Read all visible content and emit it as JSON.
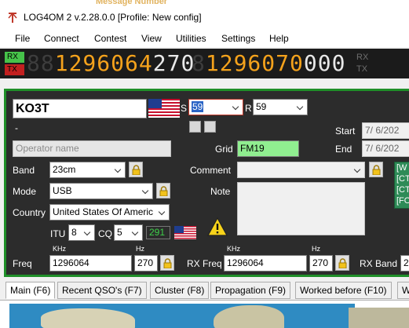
{
  "app": {
    "ghost_text": "Message Number",
    "title": "LOG4OM 2 v.2.28.0.0 [Profile: New config]"
  },
  "menu": [
    "File",
    "Connect",
    "Contest",
    "View",
    "Utilities",
    "Settings",
    "Help"
  ],
  "freq_display": {
    "rx_label": "RX",
    "tx_label": "TX",
    "left_dim": "88",
    "left_main": "1296064",
    "left_hz": "270",
    "right_dim": "8",
    "right_main": "1296070",
    "right_hz": "000",
    "side_rx": "RX",
    "side_tx": "TX",
    "colors": {
      "rx_on": "#46c34a",
      "tx": "#c22020",
      "digits": "#f4a21c"
    }
  },
  "qso": {
    "callsign": "KO3T",
    "dash": "-",
    "operator_placeholder": "Operator name",
    "s_label": "S",
    "s_value": "59",
    "r_label": "R",
    "r_value": "59",
    "start_label": "Start",
    "start_date": "7/ 6/202",
    "end_label": "End",
    "end_date": "7/ 6/202",
    "grid_label": "Grid",
    "grid_value": "FM19",
    "band_label": "Band",
    "band_value": "23cm",
    "mode_label": "Mode",
    "mode_value": "USB",
    "country_label": "Country",
    "country_value": "United States Of Americ",
    "itu_label": "ITU",
    "itu_value": "8",
    "cq_label": "CQ",
    "cq_value": "5",
    "dxcc_value": "291",
    "comment_label": "Comment",
    "comment_value": "",
    "note_label": "Note",
    "khz_label": "KHz",
    "hz_label": "Hz",
    "freq_label": "Freq",
    "freq_value": "1296064",
    "freq_hz": "270",
    "rx_freq_label": "RX Freq",
    "rx_freq_value": "1296064",
    "rx_freq_hz": "270",
    "rx_band_label": "RX Band",
    "rx_band_value": "2",
    "side_items": [
      "[W",
      "[CT",
      "[CT",
      "[FO"
    ]
  },
  "tabs": [
    "Main (F6)",
    "Recent QSO's (F7)",
    "Cluster (F8)",
    "Propagation (F9)",
    "Worked before (F10)",
    "W"
  ]
}
